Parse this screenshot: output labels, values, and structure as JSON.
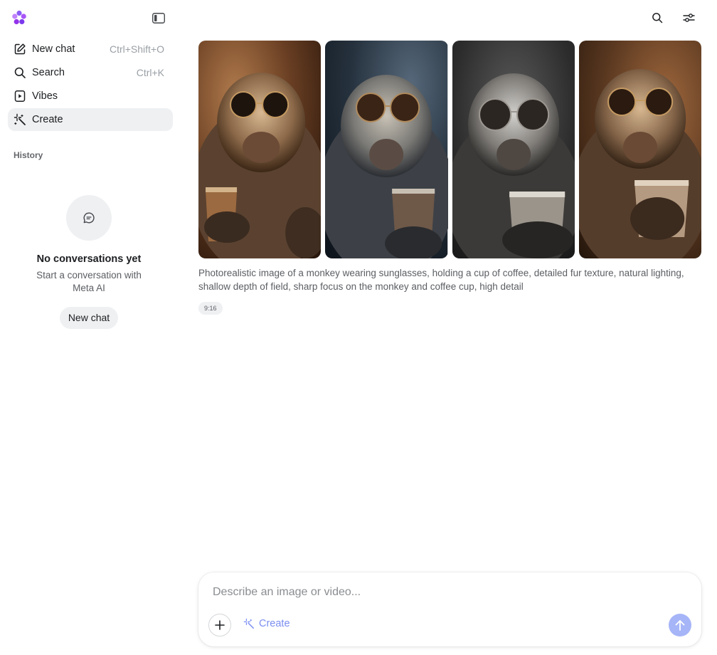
{
  "sidebar": {
    "nav": [
      {
        "label": "New chat",
        "shortcut": "Ctrl+Shift+O",
        "icon": "edit-icon"
      },
      {
        "label": "Search",
        "shortcut": "Ctrl+K",
        "icon": "search-icon"
      },
      {
        "label": "Vibes",
        "shortcut": "",
        "icon": "play-icon"
      },
      {
        "label": "Create",
        "shortcut": "",
        "icon": "sparkle-icon",
        "active": true
      }
    ],
    "history_title": "History",
    "empty_state": {
      "title": "No conversations yet",
      "subtitle": "Start a conversation with Meta AI",
      "button": "New chat"
    }
  },
  "gallery": {
    "images": [
      {
        "alt": "monkey with sunglasses and coffee 1",
        "tone": "#5a3a25"
      },
      {
        "alt": "monkey with sunglasses and coffee 2",
        "tone": "#2d3a48"
      },
      {
        "alt": "monkey with sunglasses and coffee 3",
        "tone": "#3a3a3a"
      },
      {
        "alt": "monkey with sunglasses and coffee 4",
        "tone": "#4a3322"
      }
    ],
    "caption": "Photorealistic image of a monkey wearing sunglasses, holding a cup of coffee, detailed fur texture, natural lighting, shallow depth of field, sharp focus on the monkey and coffee cup, high detail",
    "aspect_ratio": "9:16"
  },
  "composer": {
    "placeholder": "Describe an image or video...",
    "create_label": "Create"
  },
  "colors": {
    "accent": "#7b8ef0",
    "send_button": "#a6b5f7",
    "active_bg": "#eef0f2"
  }
}
